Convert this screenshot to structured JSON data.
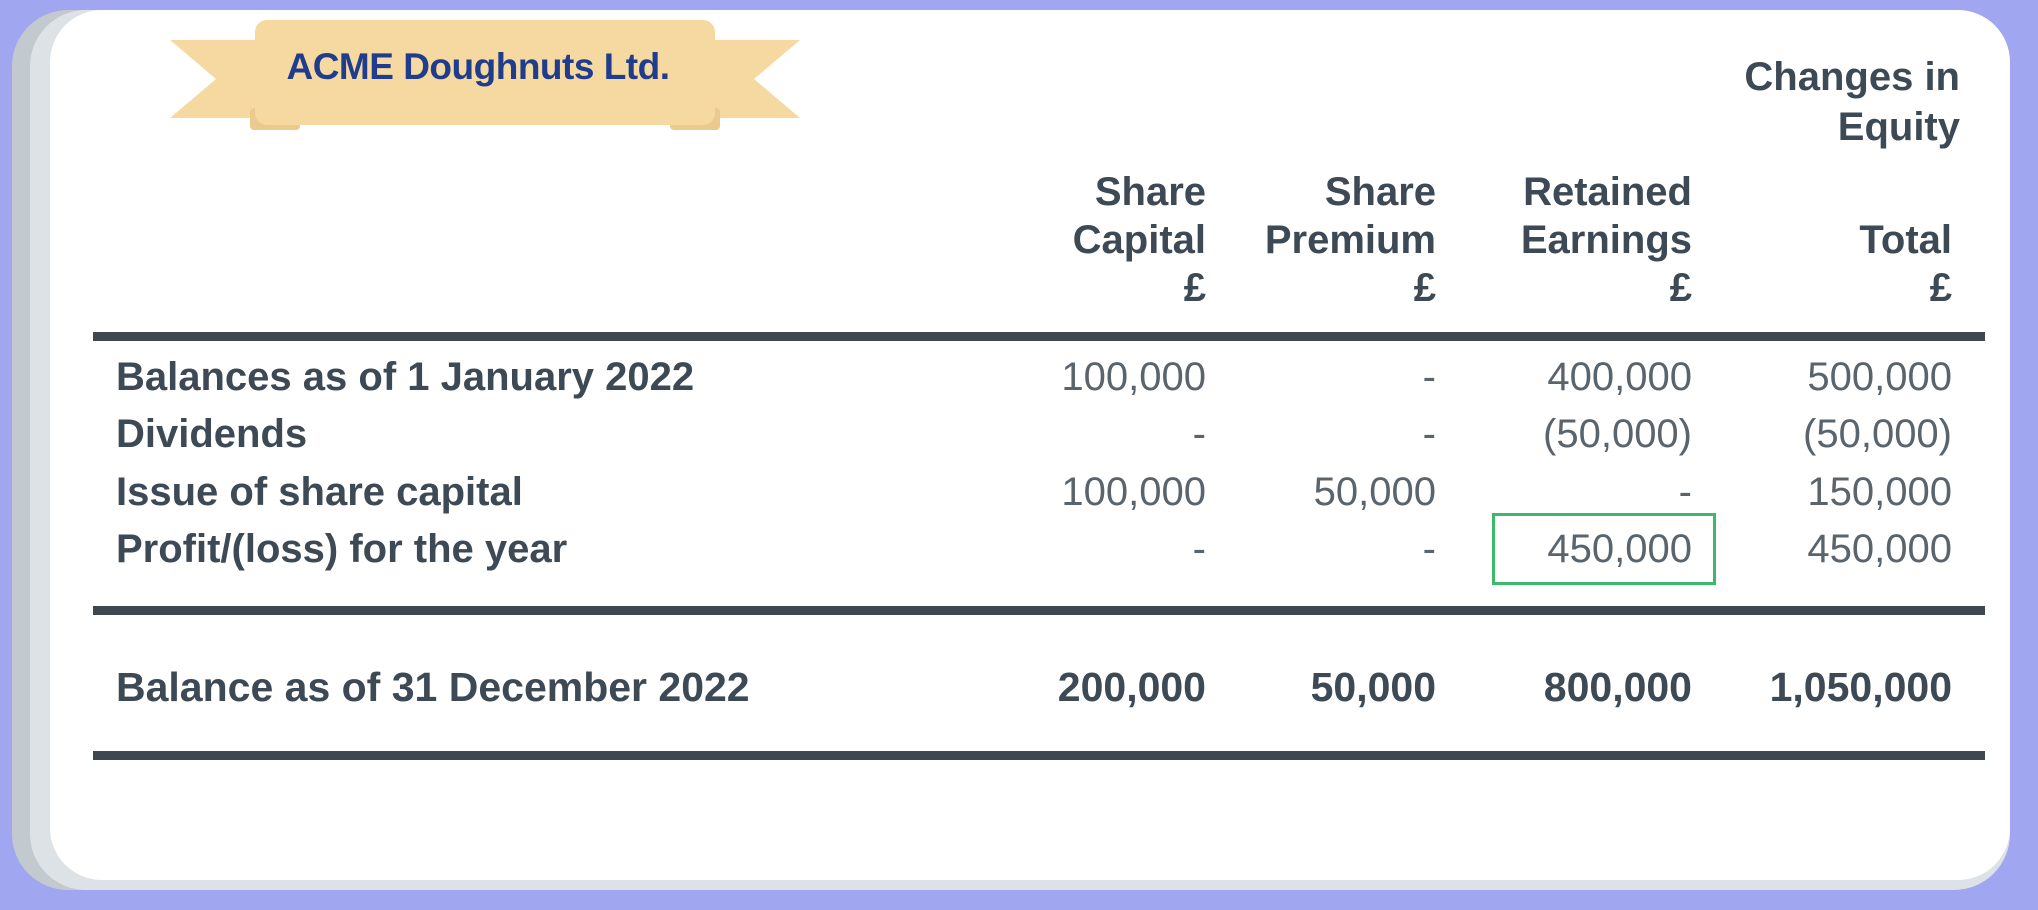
{
  "banner": {
    "company": "ACME Doughnuts Ltd."
  },
  "report_title": "Changes in\nEquity",
  "columns": [
    {
      "header": "Share\nCapital\n£"
    },
    {
      "header": "Share\nPremium\n£"
    },
    {
      "header": "Retained\nEarnings\n£"
    },
    {
      "header": "Total\n£"
    }
  ],
  "rows": [
    {
      "label": "Balances as of 1 January 2022",
      "values": [
        "100,000",
        "-",
        "400,000",
        "500,000"
      ]
    },
    {
      "label": "Dividends",
      "values": [
        "-",
        "-",
        "(50,000)",
        "(50,000)"
      ]
    },
    {
      "label": "Issue of share capital",
      "values": [
        "100,000",
        "50,000",
        "-",
        "150,000"
      ]
    },
    {
      "label": "Profit/(loss) for the year",
      "values": [
        "-",
        "-",
        "450,000",
        "450,000"
      ]
    }
  ],
  "total_row": {
    "label": "Balance as of 31 December 2022",
    "values": [
      "200,000",
      "50,000",
      "800,000",
      "1,050,000"
    ]
  },
  "colors": {
    "background": "#a0a6f0",
    "banner": "#f5d9a0",
    "highlight": "#3cb96b",
    "text": "#3d4a55"
  }
}
